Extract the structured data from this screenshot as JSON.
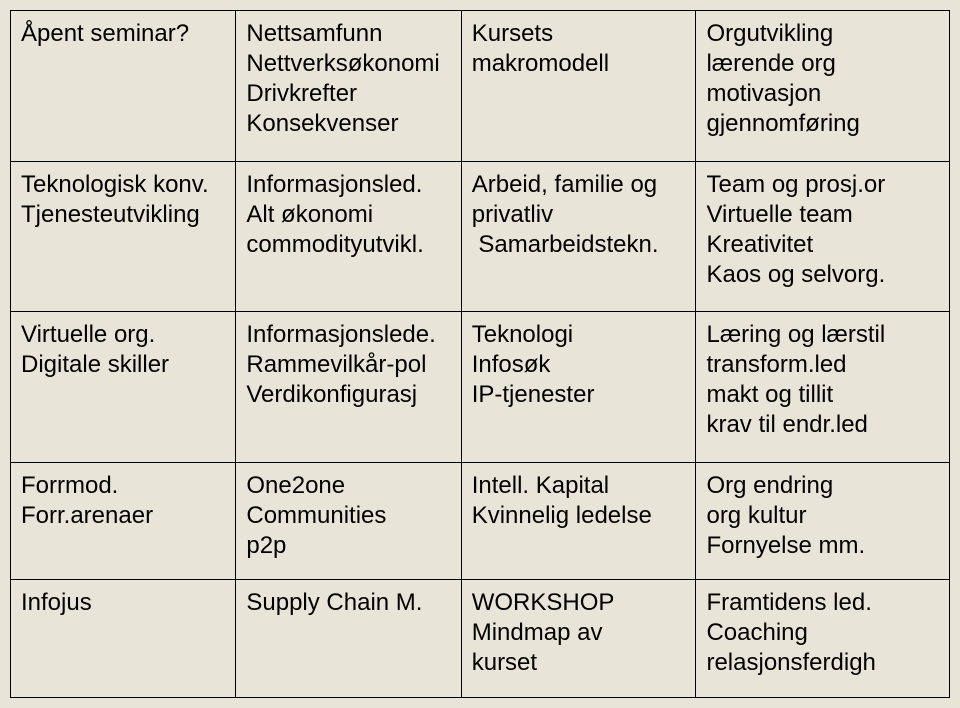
{
  "grid": {
    "rows": [
      {
        "c0": [
          "Åpent seminar?"
        ],
        "c1": [
          "Nettsamfunn",
          "Nettverksøkonomi",
          "Drivkrefter",
          "Konsekvenser"
        ],
        "c2": [
          "Kursets",
          "makromodell"
        ],
        "c3": [
          "Orgutvikling",
          "lærende org",
          "motivasjon",
          "gjennomføring"
        ]
      },
      {
        "c0": [
          "Teknologisk konv.",
          "Tjenesteutvikling"
        ],
        "c1": [
          "Informasjonsled.",
          "Alt økonomi",
          "commodityutvikl."
        ],
        "c2": [
          "Arbeid, familie og",
          "privatliv",
          " Samarbeidstekn."
        ],
        "c3": [
          "Team og prosj.or",
          "Virtuelle team",
          "Kreativitet",
          "Kaos og selvorg."
        ]
      },
      {
        "c0": [
          "Virtuelle org.",
          "Digitale skiller"
        ],
        "c1": [
          "Informasjonslede.",
          "Rammevilkår-pol",
          "Verdikonfigurasj"
        ],
        "c2": [
          "Teknologi",
          "Infosøk",
          "IP-tjenester"
        ],
        "c3": [
          "Læring og lærstil",
          "transform.led",
          "makt og tillit",
          "krav til endr.led"
        ]
      },
      {
        "c0": [
          "Forrmod.",
          "Forr.arenaer"
        ],
        "c1": [
          "One2one",
          "Communities",
          "p2p"
        ],
        "c2": [
          "Intell. Kapital",
          "Kvinnelig ledelse"
        ],
        "c3": [
          "Org endring",
          "org kultur",
          "Fornyelse mm."
        ]
      },
      {
        "c0": [
          "Infojus"
        ],
        "c1": [
          "Supply Chain M."
        ],
        "c2": [
          "WORKSHOP",
          "Mindmap av",
          "kurset"
        ],
        "c3": [
          "Framtidens led.",
          "Coaching",
          "relasjonsferdigh"
        ]
      }
    ]
  }
}
